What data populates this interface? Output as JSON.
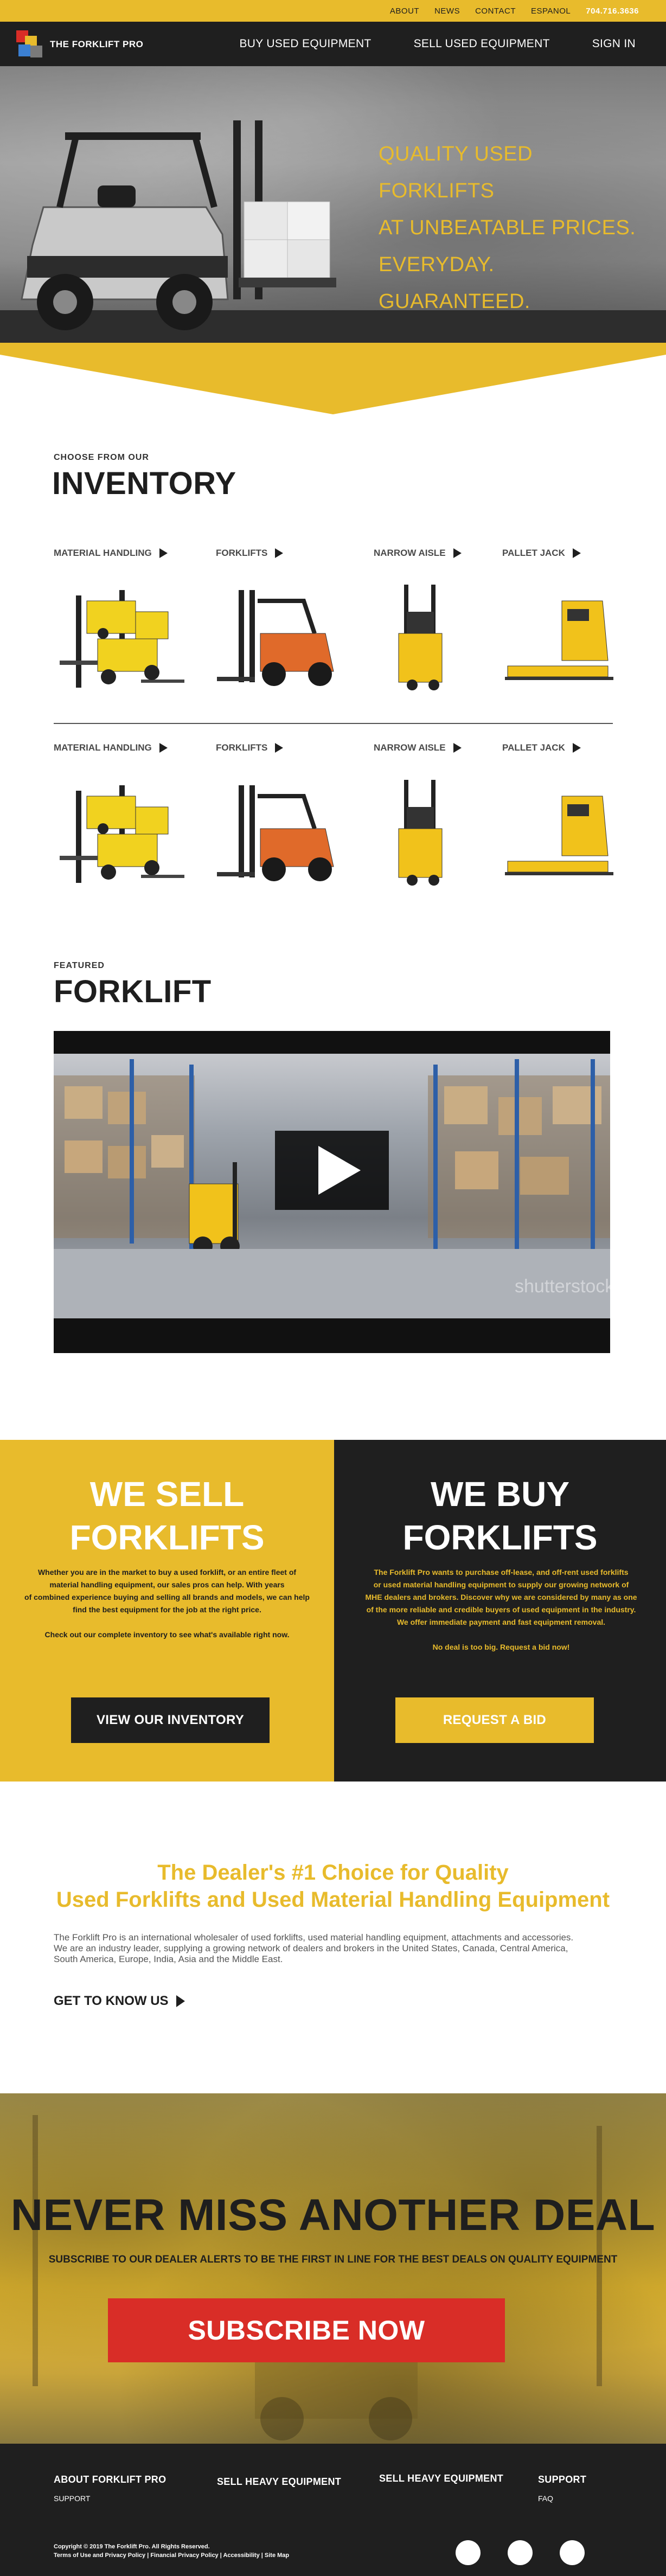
{
  "utility_nav": {
    "about": "ABOUT",
    "news": "NEWS",
    "contact": "CONTACT",
    "espanol": "ESPANOL",
    "phone": "704.716.3636"
  },
  "header": {
    "logo_text": "THE FORKLIFT PRO",
    "nav": [
      "BUY USED EQUIPMENT",
      "SELL USED EQUIPMENT",
      "SIGN IN"
    ]
  },
  "hero": {
    "lines": [
      "QUALITY USED FORKLIFTS",
      "AT UNBEATABLE PRICES.",
      "EVERYDAY. GUARANTEED."
    ]
  },
  "inventory": {
    "kicker": "CHOOSE FROM OUR",
    "title": "INVENTORY",
    "row1": [
      "MATERIAL HANDLING",
      "FORKLIFTS",
      "NARROW AISLE",
      "PALLET JACK"
    ],
    "row2": [
      "MATERIAL HANDLING",
      "FORKLIFTS",
      "NARROW AISLE",
      "PALLET JACK"
    ]
  },
  "featured": {
    "kicker": "FEATURED",
    "title": "FORKLIFT",
    "watermark": "shutterstock"
  },
  "sell": {
    "title_line1": "WE SELL",
    "title_line2": "FORKLIFTS",
    "body_lines": [
      "Whether you are in the market to buy a used forklift, or an entire fleet of",
      "material handling equipment, our sales pros can help. With years",
      "of combined experience buying and selling all brands and models, we can help",
      "find the best equipment for the job at the right price."
    ],
    "body_2": "Check out our complete inventory to see what's available right now.",
    "button": "VIEW OUR INVENTORY"
  },
  "buy": {
    "title_line1": "WE BUY",
    "title_line2": "FORKLIFTS",
    "body_lines": [
      "The Forklift Pro wants to purchase off-lease, and off-rent used forklifts",
      "or used material handling equipment to supply our growing network of",
      "MHE dealers and brokers.  Discover why we are considered by many as one",
      "of the more reliable and credible buyers of used equipment in the industry.",
      "We offer immediate payment and fast equipment removal."
    ],
    "body_2": "No deal is too big. Request a bid now!",
    "button": "REQUEST A BID"
  },
  "dealer": {
    "heading_line1": "The Dealer's #1 Choice for Quality",
    "heading_line2": "Used Forklifts and Used Material Handling Equipment",
    "para_lines": [
      "The Forklift Pro is an international wholesaler of used forklifts, used material handling equipment, attachments and accessories.",
      "We are an industry leader, supplying a growing network of dealers and brokers in the United States, Canada, Central America,",
      "South America, Europe, India, Asia and the Middle East."
    ],
    "cta": "GET TO KNOW US"
  },
  "deal": {
    "title": "NEVER MISS ANOTHER DEAL",
    "subtitle": "SUBSCRIBE TO OUR DEALER ALERTS TO BE THE FIRST IN LINE FOR THE BEST DEALS ON QUALITY EQUIPMENT",
    "button": "SUBSCRIBE NOW"
  },
  "footer": {
    "col1_title": "ABOUT FORKLIFT PRO",
    "col1_sub": "SUPPORT",
    "col2_title": "SELL HEAVY EQUIPMENT",
    "col3_title": "SELL HEAVY EQUIPMENT",
    "col4_title": "SUPPORT",
    "col4_sub": "FAQ",
    "copyright": "Copyright © 2019 The Forklift Pro. All Rights Reserved.",
    "legal": "Terms of Use and Privacy Policy | Financial Privacy Policy | Accessibility | Site Map"
  },
  "colors": {
    "brand_yellow": "#e8bb2c",
    "dark": "#1f1f1f",
    "subscribe_red": "#d92d27",
    "forklift_orange": "#e06a2a"
  },
  "icons": [
    "logo-squares-icon",
    "arrow-right-icon",
    "play-icon",
    "social-circle-icon"
  ]
}
